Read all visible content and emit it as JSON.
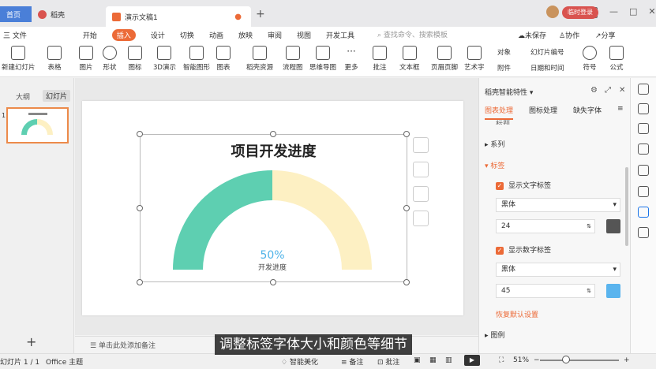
{
  "titlebar": {
    "tabs": [
      {
        "label": "首页"
      },
      {
        "label": "稻壳"
      },
      {
        "label": "演示文稿1"
      }
    ],
    "login_label": "临时登录"
  },
  "menubar": {
    "file_label": "三 文件",
    "items": [
      "开始",
      "插入",
      "设计",
      "切换",
      "动画",
      "放映",
      "审阅",
      "视图",
      "开发工具"
    ],
    "search_placeholder": "查找命令、搜索模板",
    "unsaved_label": "未保存",
    "collab_label": "协作",
    "share_label": "分享"
  },
  "toolbar": {
    "items": [
      "新建幻灯片",
      "表格",
      "图片",
      "形状",
      "图标",
      "3D演示",
      "智能图形",
      "图表",
      "稻壳资源",
      "流程图",
      "思维导图",
      "更多",
      "批注",
      "文本框",
      "页眉页脚",
      "艺术字"
    ],
    "right_items": [
      "对象",
      "附件",
      "幻灯片编号",
      "日期和时间",
      "符号",
      "公式"
    ]
  },
  "leftpanel": {
    "tab_outline": "大纲",
    "tab_slides": "幻灯片",
    "slide_number": "1"
  },
  "slide": {
    "title": "项目开发进度",
    "notes_placeholder": "单击此处添加备注"
  },
  "chart_data": {
    "type": "pie",
    "title": "项目开发进度",
    "style": "semicircle-gauge",
    "slices": [
      {
        "label": "开发进度",
        "value": 50,
        "color": "#5ecfb1"
      },
      {
        "label": "",
        "value": 50,
        "color": "#fdf0c3"
      }
    ],
    "center_value_label": "50%",
    "center_text_label": "开发进度",
    "value_color": "#4fb3e8"
  },
  "rightpanel": {
    "title": "稻壳智能特性",
    "tabs": [
      "图表处理",
      "图标处理",
      "缺失字体"
    ],
    "sections": {
      "title_section": "标题",
      "series_section": "系列",
      "label_section": "标签",
      "legend_section": "图例"
    },
    "show_text_label": "显示文字标签",
    "text_font": "黑体",
    "text_size": "24",
    "text_color": "#555555",
    "show_number_label": "显示数字标签",
    "number_font": "黑体",
    "number_size": "45",
    "number_color": "#5ab4ee",
    "reset_label": "恢复默认设置"
  },
  "statusbar": {
    "slide_info": "幻灯片 1 / 1",
    "theme": "Office 主题",
    "smart_beautify": "智能美化",
    "notes": "备注",
    "comments": "批注",
    "zoom": "51%"
  },
  "subtitle": "调整标签字体大小和颜色等细节",
  "colors": {
    "accent": "#ec6a37",
    "home_tab": "#4a7fd8"
  }
}
